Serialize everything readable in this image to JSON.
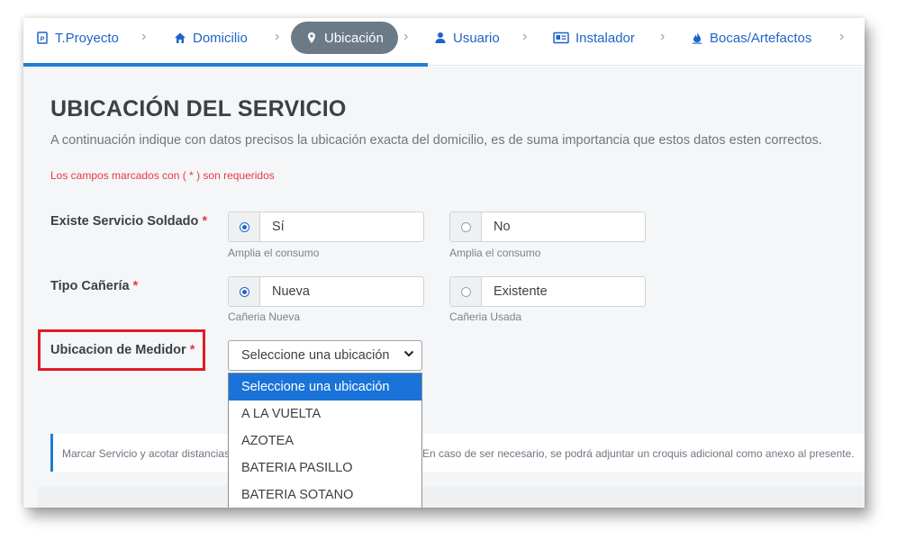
{
  "tabs": [
    {
      "label": "T.Proyecto",
      "icon": "document-icon"
    },
    {
      "label": "Domicilio",
      "icon": "home-icon"
    },
    {
      "label": "Ubicación",
      "icon": "map-pin-icon",
      "active": true
    },
    {
      "label": "Usuario",
      "icon": "user-icon"
    },
    {
      "label": "Instalador",
      "icon": "id-card-icon"
    },
    {
      "label": "Bocas/Artefactos",
      "icon": "flame-icon"
    }
  ],
  "page": {
    "title": "UBICACIÓN DEL SERVICIO",
    "description": "A continuación indique con datos precisos la ubicación exacta del domicilio, es de suma importancia que estos datos esten correctos.",
    "required_note": "Los campos marcados con ( * ) son requeridos"
  },
  "form": {
    "servicio_soldado": {
      "label": "Existe Servicio Soldado",
      "star": "*",
      "options": [
        {
          "label": "Sí",
          "help": "Amplia el consumo",
          "checked": true
        },
        {
          "label": "No",
          "help": "Amplia el consumo",
          "checked": false
        }
      ]
    },
    "tipo_caneria": {
      "label": "Tipo Cañería",
      "star": "*",
      "options": [
        {
          "label": "Nueva",
          "help": "Cañeria Nueva",
          "checked": true
        },
        {
          "label": "Existente",
          "help": "Cañeria Usada",
          "checked": false
        }
      ]
    },
    "ubicacion_medidor": {
      "label": "Ubicacion de Medidor",
      "star": "*",
      "selected": "Seleccione una ubicación",
      "options": [
        "Seleccione una ubicación",
        "A LA VUELTA",
        "AZOTEA",
        "BATERIA PASILLO",
        "BATERIA SOTANO"
      ]
    }
  },
  "note": {
    "text_left": "Marcar Servicio y acotar distancias",
    "text_right": "En caso de ser necesario, se podrá adjuntar un croquis adicional como anexo al presente."
  },
  "colors": {
    "accent": "#1f64c8",
    "active_tab": "#6c7a86",
    "required": "#e63946",
    "highlight": "#e21b23"
  }
}
